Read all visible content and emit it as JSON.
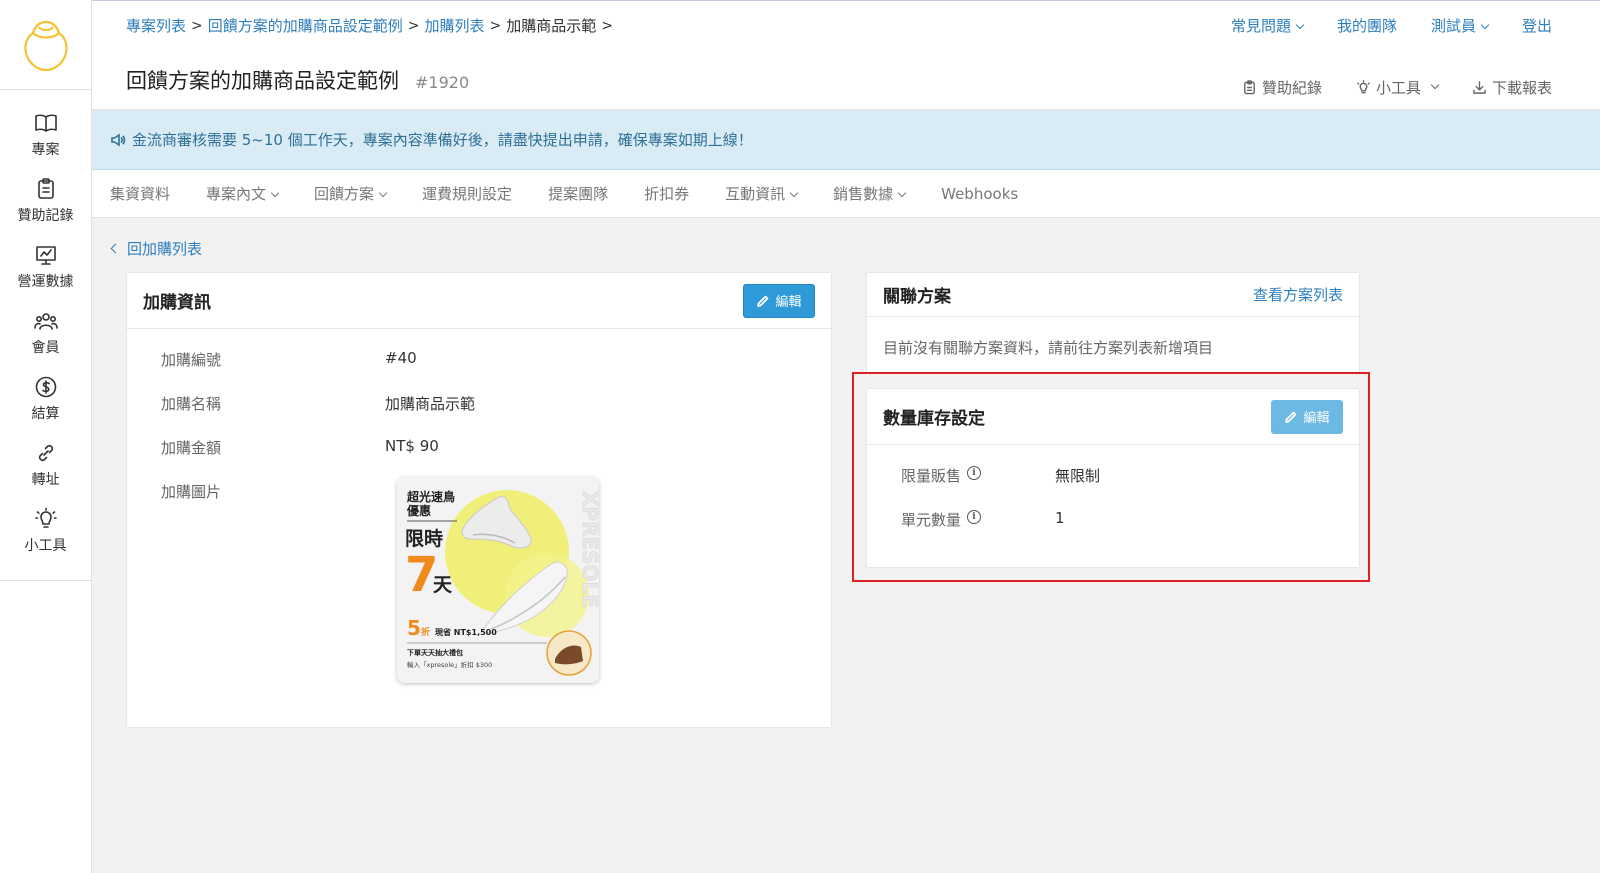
{
  "sidebar": {
    "items": [
      {
        "label": "專案",
        "icon": "book-icon"
      },
      {
        "label": "贊助記錄",
        "icon": "clipboard-icon"
      },
      {
        "label": "營運數據",
        "icon": "chart-board-icon"
      },
      {
        "label": "會員",
        "icon": "users-icon"
      },
      {
        "label": "結算",
        "icon": "dollar-icon"
      },
      {
        "label": "轉址",
        "icon": "link-icon"
      },
      {
        "label": "小工具",
        "icon": "bulb-icon"
      }
    ]
  },
  "header": {
    "breadcrumb": [
      "專案列表",
      "回饋方案的加購商品設定範例",
      "加購列表",
      "加購商品示範"
    ],
    "title": "回饋方案的加購商品設定範例",
    "id": "#1920",
    "links": {
      "faq": "常見問題",
      "team": "我的團隊",
      "user": "測試員",
      "logout": "登出"
    },
    "tools": {
      "sponsor_log": "贊助紀錄",
      "gadgets": "小工具",
      "download": "下載報表"
    }
  },
  "announcement": "金流商審核需要 5~10 個工作天，專案內容準備好後，請盡快提出申請，確保專案如期上線！",
  "tabs": [
    "集資資料",
    "專案內文",
    "回饋方案",
    "運費規則設定",
    "提案團隊",
    "折扣券",
    "互動資訊",
    "銷售數據",
    "Webhooks"
  ],
  "back_link": "回加購列表",
  "addon_card": {
    "title": "加購資訊",
    "edit_label": "編輯",
    "fields": {
      "id_label": "加購編號",
      "id_value": "#40",
      "name_label": "加購名稱",
      "name_value": "加購商品示範",
      "price_label": "加購金額",
      "price_value": "NT$ 90",
      "image_label": "加購圖片"
    },
    "image": {
      "headline1": "超光速鳥",
      "headline2": "優惠",
      "limit": "限時",
      "days_num": "7",
      "days_unit": "天",
      "discount_num": "5",
      "discount_unit": "折",
      "saving": "現省 NT$1,500",
      "promo1": "下單天天抽大禮包",
      "promo2": "輸入「xpresole」折扣 $300",
      "brand": "XPRESOLE"
    }
  },
  "linked_card": {
    "title": "關聯方案",
    "view_link": "查看方案列表",
    "empty_text": "目前沒有關聯方案資料，請前往方案列表新增項目"
  },
  "stock_card": {
    "title": "數量庫存設定",
    "edit_label": "編輯",
    "fields": {
      "limit_label": "限量販售",
      "limit_value": "無限制",
      "unit_label": "單元數量",
      "unit_value": "1"
    }
  },
  "colors": {
    "accent": "#2f9ad8",
    "link": "#2e7fbf",
    "highlight": "#e02020",
    "banner": "#d9ecf5",
    "logo": "#f2c230"
  }
}
